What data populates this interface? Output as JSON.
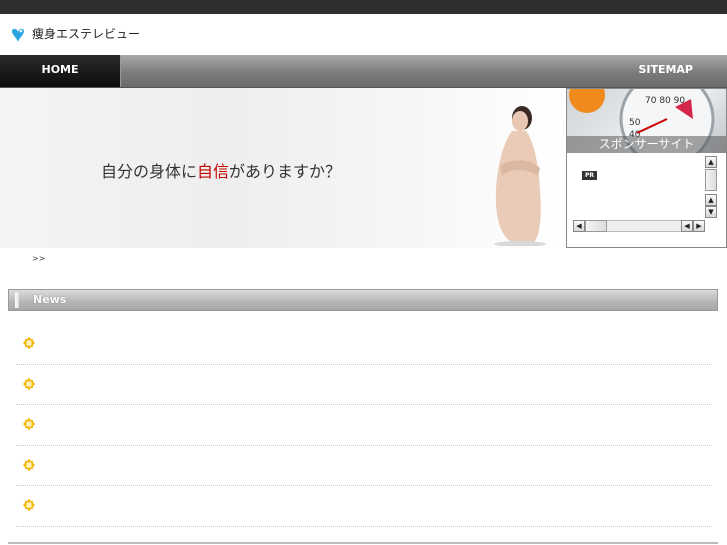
{
  "header": {
    "site_title": "痩身エステレビュー",
    "logo_icon": "heart-bird-icon",
    "accent": "#2aa7e0"
  },
  "nav": {
    "home_label": "HOME",
    "sitemap_label": "SITEMAP"
  },
  "hero": {
    "text_before": "自分の身体に",
    "text_highlight": "自信",
    "text_after": "がありますか？",
    "highlight_color": "#c40000"
  },
  "sponsor": {
    "title": "スポンサーサイト",
    "badge": "PR"
  },
  "breadcrumb": {
    "text": ">>"
  },
  "news": {
    "heading": "News",
    "items": [
      "",
      "",
      "",
      "",
      ""
    ],
    "item_icon": "sun-flower-icon"
  }
}
